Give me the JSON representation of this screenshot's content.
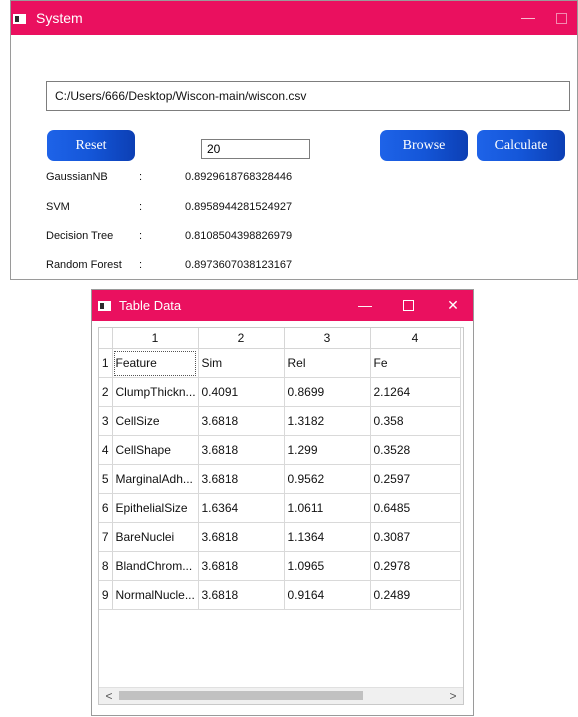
{
  "main_window": {
    "title": "System",
    "file_path": "C:/Users/666/Desktop/Wiscon-main/wiscon.csv",
    "number_value": "20",
    "buttons": {
      "reset": "Reset",
      "browse": "Browse",
      "calculate": "Calculate"
    },
    "colon": ":",
    "results": [
      {
        "name": "GaussianNB",
        "value": "0.8929618768328446"
      },
      {
        "name": "SVM",
        "value": "0.8958944281524927"
      },
      {
        "name": "Decision Tree",
        "value": "0.8108504398826979"
      },
      {
        "name": "Random Forest",
        "value": "0.8973607038123167"
      }
    ],
    "title_bar_color": "#ea105f",
    "button_color": "#1456d8"
  },
  "table_window": {
    "title": "Table Data",
    "controls": {
      "minimize": "—",
      "close": "✕"
    },
    "column_headers": [
      "1",
      "2",
      "3",
      "4"
    ],
    "row_headers": [
      "1",
      "2",
      "3",
      "4",
      "5",
      "6",
      "7",
      "8",
      "9"
    ],
    "rows": [
      [
        "Feature",
        "Sim",
        "Rel",
        "Fe"
      ],
      [
        "ClumpThickn...",
        "0.4091",
        "0.8699",
        "2.1264"
      ],
      [
        "CellSize",
        "3.6818",
        "1.3182",
        "0.358"
      ],
      [
        "CellShape",
        "3.6818",
        "1.299",
        "0.3528"
      ],
      [
        "MarginalAdh...",
        "3.6818",
        "0.9562",
        "0.2597"
      ],
      [
        "EpithelialSize",
        "1.6364",
        "1.0611",
        "0.6485"
      ],
      [
        "BareNuclei",
        "3.6818",
        "1.1364",
        "0.3087"
      ],
      [
        "BlandChrom...",
        "3.6818",
        "1.0965",
        "0.2978"
      ],
      [
        "NormalNucle...",
        "3.6818",
        "0.9164",
        "0.2489"
      ]
    ],
    "scroll": {
      "left_arrow": "<",
      "right_arrow": ">"
    }
  }
}
